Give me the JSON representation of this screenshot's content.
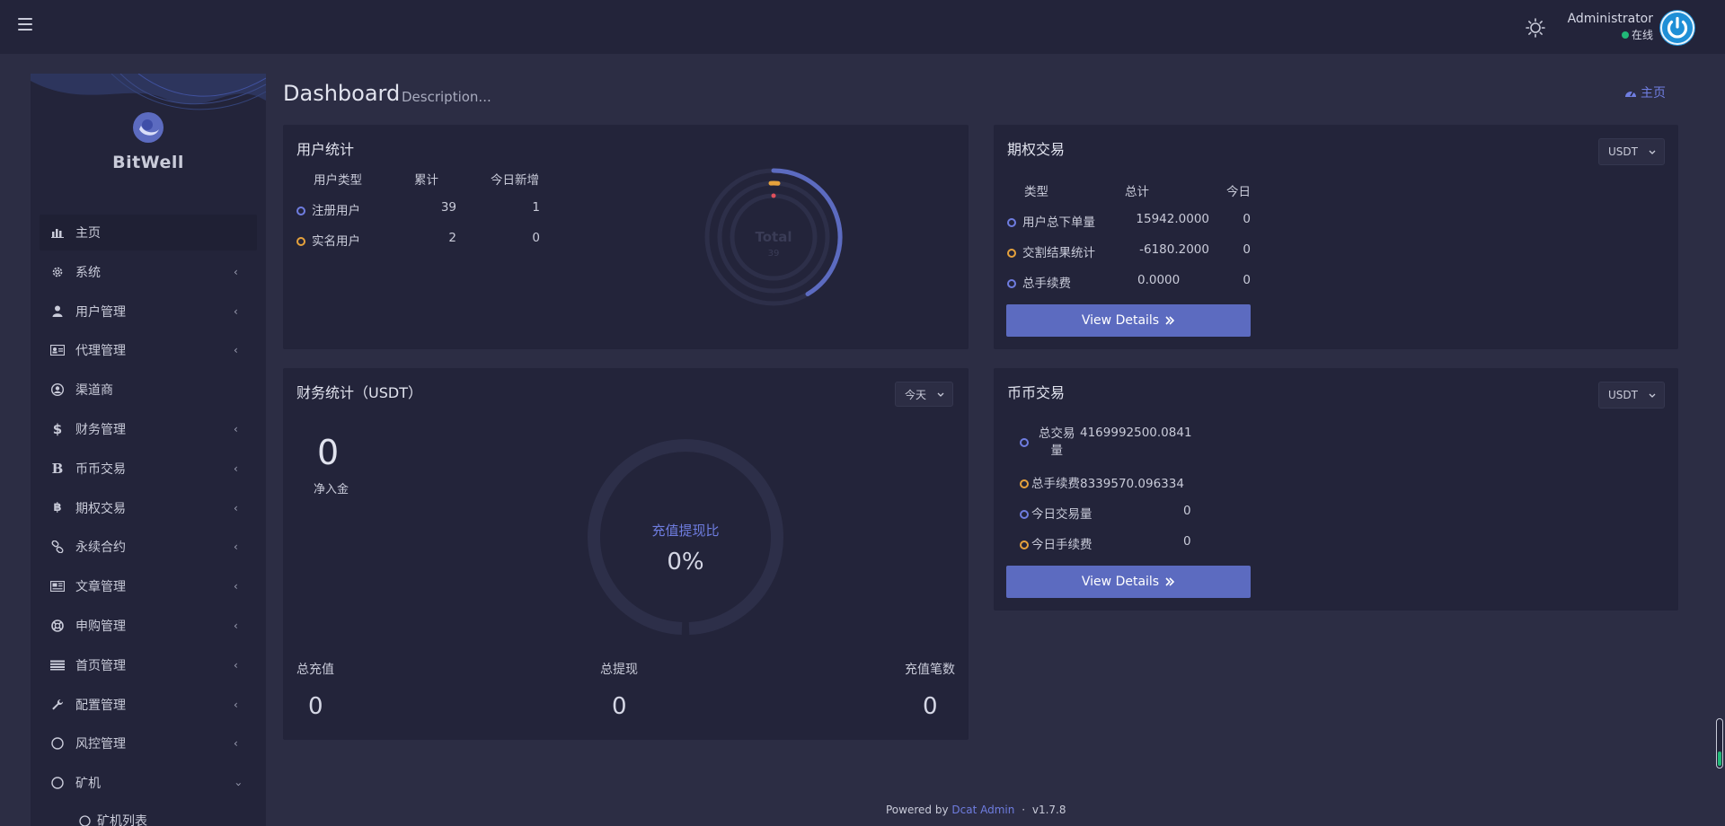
{
  "topbar": {
    "user_name": "Administrator",
    "user_status": "在线"
  },
  "sidebar": {
    "brand": "BitWell",
    "items": [
      {
        "label": "主页",
        "icon": "bar-chart-icon"
      },
      {
        "label": "系统",
        "icon": "gear-icon"
      },
      {
        "label": "用户管理",
        "icon": "user-icon"
      },
      {
        "label": "代理管理",
        "icon": "id-card-icon"
      },
      {
        "label": "渠道商",
        "icon": "user-circle-icon"
      },
      {
        "label": "财务管理",
        "icon": "dollar-icon"
      },
      {
        "label": "币币交易",
        "icon": "b-letter-icon"
      },
      {
        "label": "期权交易",
        "icon": "bitcoin-icon"
      },
      {
        "label": "永续合约",
        "icon": "link-icon"
      },
      {
        "label": "文章管理",
        "icon": "newspaper-icon"
      },
      {
        "label": "申购管理",
        "icon": "life-ring-icon"
      },
      {
        "label": "首页管理",
        "icon": "list-icon"
      },
      {
        "label": "配置管理",
        "icon": "wrench-icon"
      },
      {
        "label": "风控管理",
        "icon": "circle-icon"
      },
      {
        "label": "矿机",
        "icon": "circle-icon"
      }
    ],
    "subitems": [
      {
        "label": "矿机列表"
      }
    ]
  },
  "header": {
    "title": "Dashboard",
    "description": "Description...",
    "breadcrumb": "主页"
  },
  "user_stats": {
    "title": "用户统计",
    "columns": [
      "用户类型",
      "累计",
      "今日新增"
    ],
    "rows": [
      {
        "type": "注册用户",
        "total": "39",
        "today": "1",
        "color": "#6f7de0"
      },
      {
        "type": "实名用户",
        "total": "2",
        "today": "0",
        "color": "#e6a23c"
      }
    ],
    "chart_center_label": "Total",
    "chart_center_value": "39"
  },
  "options_trade": {
    "title": "期权交易",
    "currency": "USDT",
    "columns": [
      "类型",
      "总计",
      "今日"
    ],
    "rows": [
      {
        "type": "用户总下单量",
        "total": "15942.0000",
        "today": "0"
      },
      {
        "type": "交割结果统计",
        "total": "-6180.2000",
        "today": "0"
      },
      {
        "type": "总手续费",
        "total": "0.0000",
        "today": "0"
      }
    ],
    "button": "View Details"
  },
  "finance": {
    "title": "财务统计（USDT）",
    "period": "今天",
    "net_value": "0",
    "net_label": "净入金",
    "ratio_label": "充值提现比",
    "ratio_value": "0%",
    "totals": [
      {
        "label": "总充值",
        "value": "0"
      },
      {
        "label": "总提现",
        "value": "0"
      },
      {
        "label": "充值笔数",
        "value": "0"
      }
    ]
  },
  "coin_trade": {
    "title": "币币交易",
    "currency": "USDT",
    "rows": [
      {
        "label": "总交易",
        "label2": "量",
        "value": "4169992500.0841"
      },
      {
        "label": "总手续费",
        "value": "8339570.096334"
      },
      {
        "label": "今日交易量",
        "value": "0"
      },
      {
        "label": "今日手续费",
        "value": "0"
      }
    ],
    "button": "View Details"
  },
  "footer": {
    "powered": "Powered by",
    "link": "Dcat Admin",
    "sep": "·",
    "version": "v1.7.8"
  },
  "colors": {
    "accent": "#5c6bc0",
    "orange": "#e6a23c",
    "panel": "#23243a",
    "background": "#2c2d44",
    "online": "#21b978"
  }
}
